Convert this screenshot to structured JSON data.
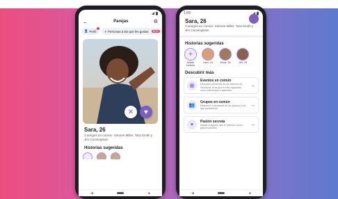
{
  "left_phone": {
    "time": "",
    "appbar": {
      "back_icon": "arrow-left-icon",
      "title": "Parejas",
      "settings_icon": "gear-icon"
    },
    "chips": [
      {
        "icon": "person-icon",
        "label": "Perfil"
      },
      {
        "icon": "heart-icon",
        "label": "Personas a las que les gustas",
        "badge": "NEW"
      }
    ],
    "profile": {
      "name": "Sara, 26",
      "common": "3 amigos en común: Simone Miller, Tara Smith y Jim Cunningham"
    },
    "section_stories": "Historias sugeridas"
  },
  "right_phone": {
    "time": "1:03",
    "profile": {
      "name": "Sara, 26",
      "common": "3 amigos en común: Simone Miller, Tara Smith y Jim Cunningham"
    },
    "section_stories": "Historias sugeridas",
    "stories": [
      {
        "label": "Añadir historia"
      },
      {
        "label": "Lara, 24"
      },
      {
        "label": "Anna, 28"
      },
      {
        "label": "Jeff, 25"
      }
    ],
    "section_discover": "Descubrir más",
    "discover": [
      {
        "icon": "calendar-icon",
        "title": "Eventos en común",
        "desc": "Descubre personas de los eventos de Facebook a los que te has registrado como interesado o asistente"
      },
      {
        "icon": "group-icon",
        "title": "Grupos en común",
        "desc": "Descubre a personas de los grupos a los que perteneces"
      },
      {
        "icon": "heart-message-icon",
        "title": "Pasión secreta",
        "desc": "Añade a alguien que te interese como pasión secreta"
      }
    ]
  },
  "colors": {
    "accent": "#7b5ec2",
    "gradient_start": "#ec4d7f",
    "gradient_end": "#5e79cf"
  }
}
